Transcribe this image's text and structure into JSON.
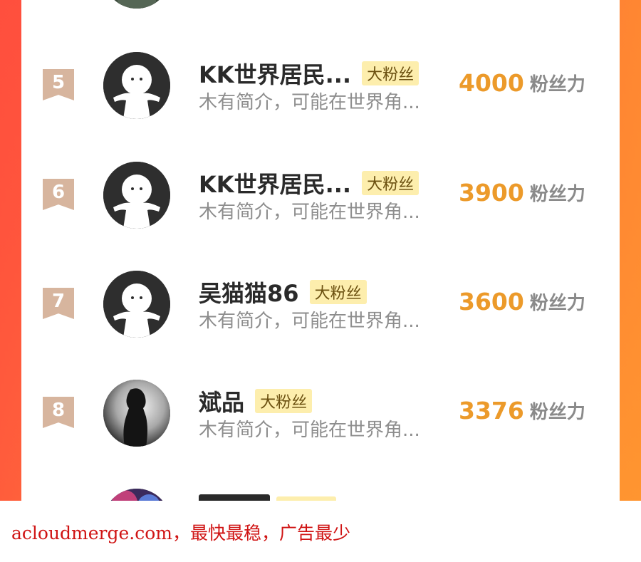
{
  "footer": {
    "text": "acloudmerge.com，最快最稳，广告最少"
  },
  "score_unit": "粉丝力",
  "rows": [
    {
      "rank": "5",
      "name": "KK世界居民...",
      "badge": "大粉丝",
      "intro": "木有简介，可能在世界角...",
      "score": "4000",
      "avatar_icon": "default-avatar-icon"
    },
    {
      "rank": "6",
      "name": "KK世界居民...",
      "badge": "大粉丝",
      "intro": "木有简介，可能在世界角...",
      "score": "3900",
      "avatar_icon": "default-avatar-icon"
    },
    {
      "rank": "7",
      "name": "吴猫猫86",
      "badge": "大粉丝",
      "intro": "木有简介，可能在世界角...",
      "score": "3600",
      "avatar_icon": "default-avatar-icon"
    },
    {
      "rank": "8",
      "name": "斌品",
      "badge": "大粉丝",
      "intro": "木有简介，可能在世界角...",
      "score": "3376",
      "avatar_icon": "photo-avatar-icon"
    }
  ],
  "colors": {
    "background_left": "#ff4a3e",
    "background_right": "#ff9a2e",
    "rank_badge": "#d7b59e",
    "score": "#ec9a2a",
    "fan_badge_bg": "#fdeead",
    "footer_text": "#d01414"
  }
}
